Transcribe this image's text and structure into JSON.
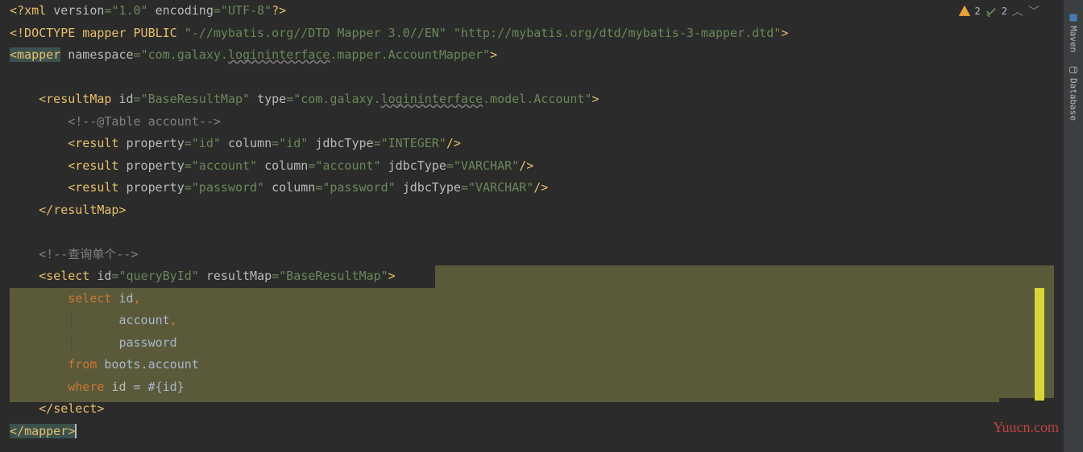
{
  "status": {
    "warnings": "2",
    "checks": "2"
  },
  "sidebar": {
    "maven": "Maven",
    "database": "Database"
  },
  "watermark": "Yuucn.com",
  "code": {
    "l1_xml": "xml",
    "l1_version_attr": "version",
    "l1_version_val": "\"1.0\"",
    "l1_encoding_attr": "encoding",
    "l1_encoding_val": "\"UTF-8\"",
    "l2_doctype": "<!DOCTYPE mapper PUBLIC ",
    "l2_dtd1": "\"-//mybatis.org//DTD Mapper 3.0//EN\"",
    "l2_dtd2": "\"http://mybatis.org/dtd/mybatis-3-mapper.dtd\"",
    "l3_tag": "mapper",
    "l3_ns_attr": "namespace",
    "l3_ns1": "\"com.galaxy.",
    "l3_ns2": "logininterface",
    "l3_ns3": ".mapper.AccountMapper\"",
    "l5_tag": "resultMap",
    "l5_id_attr": "id",
    "l5_id_val": "\"BaseResultMap\"",
    "l5_type_attr": "type",
    "l5_type1": "\"com.galaxy.",
    "l5_type2": "logininterface",
    "l5_type3": ".model.Account\"",
    "l6_comment": "@Table account",
    "l7_tag": "result",
    "l7_prop_attr": "property",
    "l7_prop_val": "\"id\"",
    "l7_col_attr": "column",
    "l7_col_val": "\"id\"",
    "l7_jdbc_attr": "jdbcType",
    "l7_jdbc_val": "\"INTEGER\"",
    "l8_prop_val": "\"account\"",
    "l8_col_val": "\"account\"",
    "l8_jdbc_val": "\"VARCHAR\"",
    "l9_prop_val": "\"password\"",
    "l9_col_val": "\"password\"",
    "l9_jdbc_val": "\"VARCHAR\"",
    "l10_close": "resultMap",
    "l12_comment": "查询单个",
    "l13_tag": "select",
    "l13_id_val": "\"queryById\"",
    "l13_rm_attr": "resultMap",
    "l13_rm_val": "\"BaseResultMap\"",
    "l14_select": "select",
    "l14_id": "id",
    "l15_account": "account",
    "l16_password": "password",
    "l17_from": "from",
    "l17_table": "boots.account",
    "l18_where": "where",
    "l18_id": "id",
    "l18_eq": "= #{id}",
    "l19_close": "select",
    "l20_close": "mapper"
  }
}
